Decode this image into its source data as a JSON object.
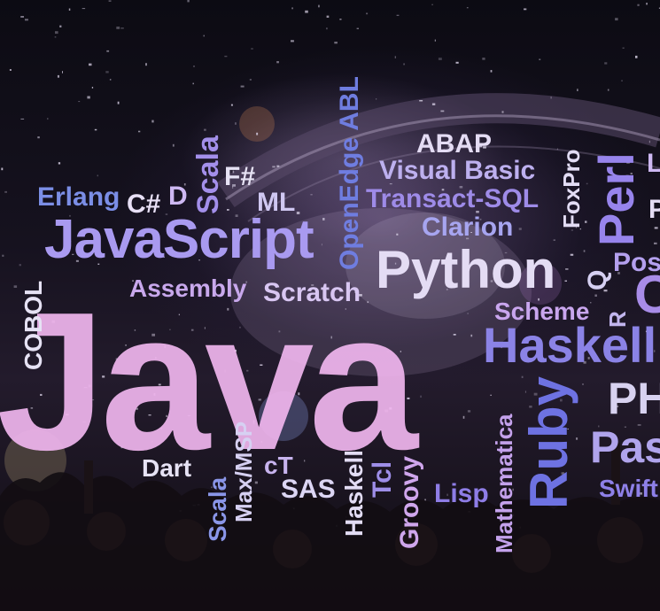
{
  "colors": {
    "background": "#0b0a14",
    "pink": "#f0b6ee",
    "light_purple": "#cdb8f2",
    "lavender": "#a9a4f1",
    "blue": "#6f86e6",
    "pale": "#e6e2f4",
    "violet": "#8e76e8"
  },
  "words": [
    {
      "id": "java",
      "text": "Java"
    },
    {
      "id": "javascript",
      "text": "JavaScript"
    },
    {
      "id": "python",
      "text": "Python"
    },
    {
      "id": "haskell-right",
      "text": "Haskell"
    },
    {
      "id": "erlang",
      "text": "Erlang"
    },
    {
      "id": "csharp",
      "text": "C#"
    },
    {
      "id": "d",
      "text": "D"
    },
    {
      "id": "scala-top",
      "text": "Scala"
    },
    {
      "id": "fsharp",
      "text": "F#"
    },
    {
      "id": "ml",
      "text": "ML"
    },
    {
      "id": "openedge-abl",
      "text": "OpenEdge ABL"
    },
    {
      "id": "abap",
      "text": "ABAP"
    },
    {
      "id": "visual-basic",
      "text": "Visual Basic"
    },
    {
      "id": "transact-sql",
      "text": "Transact-SQL"
    },
    {
      "id": "clarion",
      "text": "Clarion"
    },
    {
      "id": "foxpro",
      "text": "FoxPro"
    },
    {
      "id": "perl",
      "text": "Perl"
    },
    {
      "id": "l-fragment",
      "text": "L"
    },
    {
      "id": "p-fragment",
      "text": "P"
    },
    {
      "id": "pos-fragment",
      "text": "Pos"
    },
    {
      "id": "q",
      "text": "Q"
    },
    {
      "id": "c-fragment",
      "text": "C"
    },
    {
      "id": "assembly",
      "text": "Assembly"
    },
    {
      "id": "scratch",
      "text": "Scratch"
    },
    {
      "id": "scheme",
      "text": "Scheme"
    },
    {
      "id": "r",
      "text": "R"
    },
    {
      "id": "cobol",
      "text": "COBOL"
    },
    {
      "id": "ph-fragment",
      "text": "PH"
    },
    {
      "id": "ruby",
      "text": "Ruby"
    },
    {
      "id": "pas-fragment",
      "text": "Pas"
    },
    {
      "id": "swift",
      "text": "Swift"
    },
    {
      "id": "mathematica",
      "text": "Mathematica"
    },
    {
      "id": "lisp",
      "text": "Lisp"
    },
    {
      "id": "groovy",
      "text": "Groovy"
    },
    {
      "id": "tcl",
      "text": "Tcl"
    },
    {
      "id": "haskell-bottom",
      "text": "Haskell"
    },
    {
      "id": "sas",
      "text": "SAS"
    },
    {
      "id": "ct",
      "text": "cT"
    },
    {
      "id": "max-msp",
      "text": "Max/MSP"
    },
    {
      "id": "scala-bottom",
      "text": "Scala"
    },
    {
      "id": "dart",
      "text": "Dart"
    }
  ]
}
